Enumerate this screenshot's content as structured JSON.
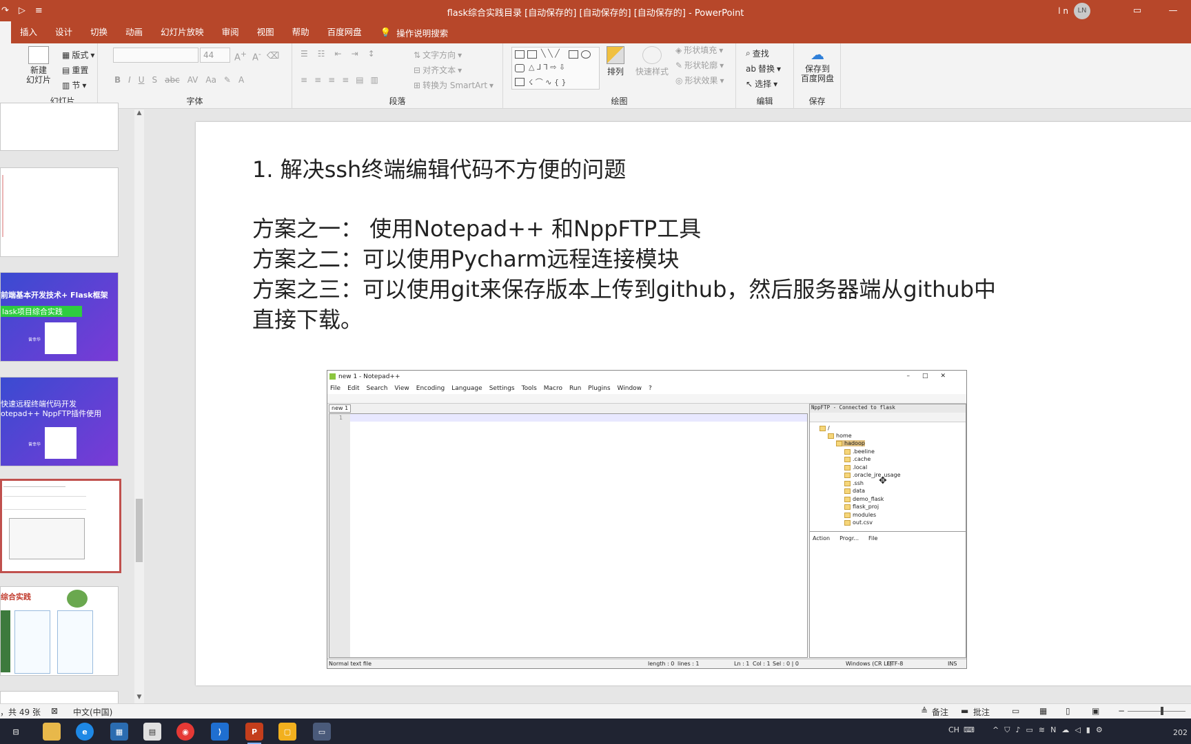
{
  "window": {
    "title": "flask综合实践目录 [自动保存的] [自动保存的] [自动保存的]  -  PowerPoint",
    "user_name": "l n",
    "user_initials": "LN",
    "accent_color": "#b7472a"
  },
  "tabs": [
    "插入",
    "设计",
    "切换",
    "动画",
    "幻灯片放映",
    "审阅",
    "视图",
    "帮助",
    "百度网盘"
  ],
  "tell_me": "操作说明搜索",
  "ribbon": {
    "slides": {
      "new_slide": "新建\n幻灯片",
      "layout": "版式",
      "reset": "重置",
      "section": "节",
      "label": "幻灯片"
    },
    "font": {
      "size": "44",
      "label": "字体"
    },
    "paragraph": {
      "text_direction": "文字方向",
      "align_text": "对齐文本",
      "smartart": "转换为 SmartArt",
      "label": "段落"
    },
    "drawing": {
      "arrange": "排列",
      "quick_styles": "快速样式",
      "fill": "形状填充",
      "outline": "形状轮廓",
      "effects": "形状效果",
      "label": "绘图"
    },
    "editing": {
      "find": "查找",
      "replace": "替换",
      "select": "选择",
      "label": "编辑"
    },
    "save": {
      "save_baidu": "保存到\n百度网盘",
      "label": "保存"
    }
  },
  "thumbnails": {
    "t3_title": "前端基本开发技术+ Flask框架",
    "t3_sub": "lask项目综合实践",
    "t4_title": "快速远程终端代码开发",
    "t4_sub": "otepad++ NppFTP插件使用",
    "t6_title": "综合实践",
    "presenter": "曾幸华"
  },
  "slide": {
    "line1": "1. 解决ssh终端编辑代码不方便的问题",
    "line2": "方案之一：  使用Notepad++ 和NppFTP工具",
    "line3": "方案之二：可以使用Pycharm远程连接模块",
    "line4": "方案之三：可以使用git来保存版本上传到github，然后服务器端从github中",
    "line5": "直接下载。"
  },
  "npp": {
    "title": "new 1 - Notepad++",
    "menu": [
      "File",
      "Edit",
      "Search",
      "View",
      "Encoding",
      "Language",
      "Settings",
      "Tools",
      "Macro",
      "Run",
      "Plugins",
      "Window",
      "?"
    ],
    "tab": "new 1",
    "line_number": "1",
    "ftp_header": "NppFTP - Connected to flask",
    "tree": [
      "/",
      "home",
      "hadoop",
      ".beeline",
      ".cache",
      ".local",
      ".oracle_jre_usage",
      ".ssh",
      "data",
      "demo_flask",
      "flask_proj",
      "modules",
      "out.csv"
    ],
    "queue_cols": [
      "Action",
      "Progr...",
      "File"
    ],
    "status": {
      "type": "Normal text file",
      "length": "length : 0",
      "lines": "lines : 1",
      "ln": "Ln : 1",
      "col": "Col : 1",
      "sel": "Sel : 0 | 0",
      "eol": "Windows (CR LF)",
      "enc": "UTF-8",
      "ins": "INS"
    }
  },
  "statusbar": {
    "slide_count": "，共 49 张",
    "language": "中文(中国)",
    "notes": "备注",
    "comments": "批注"
  },
  "taskbar": {
    "ime": "CH",
    "clock": "202"
  }
}
